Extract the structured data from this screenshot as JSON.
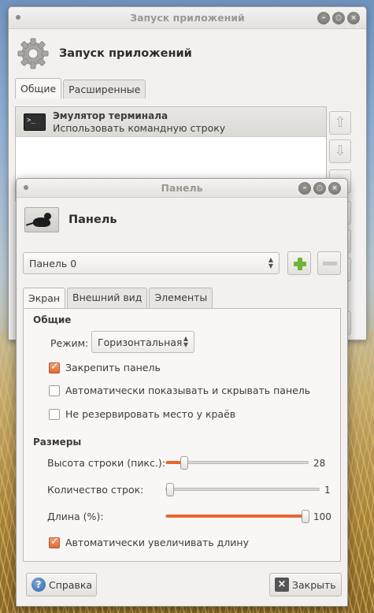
{
  "back_window": {
    "title": "Запуск приложений",
    "header_title": "Запуск приложений",
    "tabs": [
      "Общие",
      "Расширенные"
    ],
    "list": [
      {
        "name": "Эмулятор терминала",
        "description": "Использовать командную строку",
        "icon": "terminal-icon"
      }
    ]
  },
  "panel_window": {
    "title": "Панель",
    "header_title": "Панель",
    "panel_select": "Панель 0",
    "tabs": [
      "Экран",
      "Внешний вид",
      "Элементы"
    ],
    "general_section": "Общие",
    "mode_label": "Режим:",
    "mode_value": "Горизонтальная",
    "lock_panel": {
      "label": "Закрепить панель",
      "checked": true
    },
    "autohide": {
      "label": "Автоматически показывать и скрывать панель",
      "checked": false
    },
    "no_reserve": {
      "label": "Не резервировать место у краёв",
      "checked": false
    },
    "sizes_section": "Размеры",
    "row_size": {
      "label": "Высота строки (пикс.):",
      "value": "28"
    },
    "row_count": {
      "label": "Количество строк:",
      "value": "1"
    },
    "length": {
      "label": "Длина (%):",
      "value": "100"
    },
    "auto_length": {
      "label": "Автоматически увеличивать длину",
      "checked": true
    },
    "help_button": "Справка",
    "close_button": "Закрыть"
  },
  "colors": {
    "accent": "#e9662f",
    "add": "#6fb33a"
  }
}
